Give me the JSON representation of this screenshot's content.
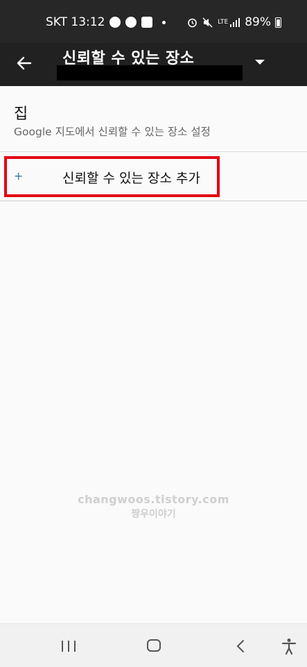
{
  "status_bar": {
    "carrier_time": "SKT 13:12",
    "battery": "89%",
    "network": "LTE"
  },
  "app_bar": {
    "title": "신뢰할 수 있는 장소"
  },
  "home_item": {
    "title": "집",
    "subtitle": "Google 지도에서 신뢰할 수 있는 장소 설정"
  },
  "add_item": {
    "icon": "+",
    "label": "신뢰할 수 있는 장소 추가"
  },
  "watermark": {
    "line1": "changwoos.tistory.com",
    "line2": "짱우이야기"
  },
  "colors": {
    "highlight": "#e30010",
    "app_bar": "#212121"
  }
}
